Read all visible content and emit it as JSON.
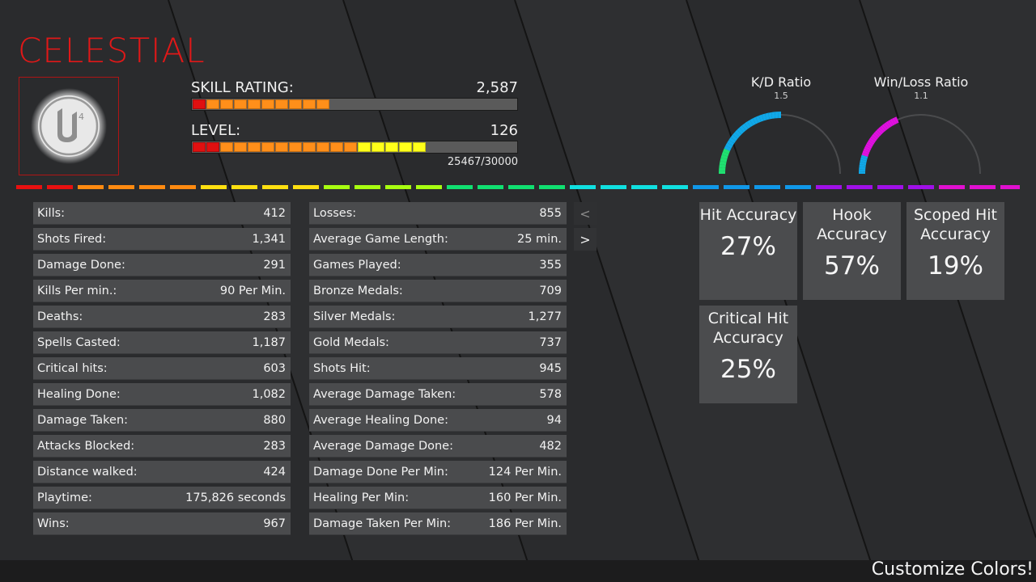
{
  "player": {
    "name": "CELESTIAL",
    "avatar_icon": "unreal-engine-logo-icon"
  },
  "skill": {
    "label": "SKILL RATING:",
    "value": "2,587",
    "segments_total": 20,
    "segment_colors": [
      "#e01010",
      "#ff8f1a",
      "#ff8f1a",
      "#ff8f1a",
      "#ff8f1a",
      "#ff8f1a",
      "#ff8f1a",
      "#ff8f1a",
      "#ff8f1a",
      "#ff8f1a"
    ]
  },
  "level": {
    "label": "LEVEL:",
    "value": "126",
    "xp": "25467/30000",
    "segments_total": 20,
    "segment_colors": [
      "#e01010",
      "#e01010",
      "#ff8f1a",
      "#ff8f1a",
      "#ff8f1a",
      "#ff8f1a",
      "#ff8f1a",
      "#ff8f1a",
      "#ff8f1a",
      "#ff8f1a",
      "#ff8f1a",
      "#ff8f1a",
      "#ffff1a",
      "#ffff1a",
      "#ffff1a",
      "#ffff1a",
      "#ffff1a"
    ]
  },
  "gauges": [
    {
      "title": "K/D Ratio",
      "value": "1.5",
      "fill": 0.5,
      "colors": [
        "#1fe070",
        "#10a8e8"
      ]
    },
    {
      "title": "Win/Loss Ratio",
      "value": "1.1",
      "fill": 0.37,
      "colors": [
        "#10a8e8",
        "#e010e0"
      ]
    }
  ],
  "rainbow_colors": [
    "#e81010",
    "#ff8a10",
    "#ffe010",
    "#a8ff10",
    "#10e070",
    "#10e0e0",
    "#1098e8",
    "#a010e8",
    "#e010d0"
  ],
  "stats_left": [
    {
      "label": "Kills:",
      "value": "412"
    },
    {
      "label": "Shots Fired:",
      "value": "1,341"
    },
    {
      "label": "Damage Done:",
      "value": "291"
    },
    {
      "label": "Kills Per min.:",
      "value": "90 Per Min."
    },
    {
      "label": "Deaths:",
      "value": "283"
    },
    {
      "label": "Spells Casted:",
      "value": "1,187"
    },
    {
      "label": "Critical hits:",
      "value": "603"
    },
    {
      "label": "Healing Done:",
      "value": "1,082"
    },
    {
      "label": "Damage Taken:",
      "value": "880"
    },
    {
      "label": "Attacks Blocked:",
      "value": "283"
    },
    {
      "label": "Distance walked:",
      "value": "424"
    },
    {
      "label": "Playtime:",
      "value": "175,826 seconds"
    },
    {
      "label": "Wins:",
      "value": "967"
    }
  ],
  "stats_right": [
    {
      "label": "Losses:",
      "value": "855"
    },
    {
      "label": "Average Game Length:",
      "value": "25 min."
    },
    {
      "label": "Games Played:",
      "value": "355"
    },
    {
      "label": "Bronze  Medals:",
      "value": "709"
    },
    {
      "label": "Silver Medals:",
      "value": "1,277"
    },
    {
      "label": "Gold Medals:",
      "value": "737"
    },
    {
      "label": "Shots Hit:",
      "value": "945"
    },
    {
      "label": "Average Damage Taken:",
      "value": "578"
    },
    {
      "label": "Average Healing Done:",
      "value": "94"
    },
    {
      "label": "Average Damage Done:",
      "value": "482"
    },
    {
      "label": "Damage Done Per Min:",
      "value": "124 Per Min."
    },
    {
      "label": "Healing Per Min:",
      "value": "160 Per Min."
    },
    {
      "label": "Damage Taken Per Min:",
      "value": "186 Per Min."
    }
  ],
  "nav": {
    "prev": "<",
    "next": ">"
  },
  "accuracy": [
    {
      "label": "Hit Accuracy",
      "value": "27%"
    },
    {
      "label": "Hook Accuracy",
      "value": "57%"
    },
    {
      "label": "Scoped Hit Accuracy",
      "value": "19%"
    },
    {
      "label": "Critical Hit Accuracy",
      "value": "25%"
    }
  ],
  "footer": {
    "customize": "Customize Colors!"
  }
}
